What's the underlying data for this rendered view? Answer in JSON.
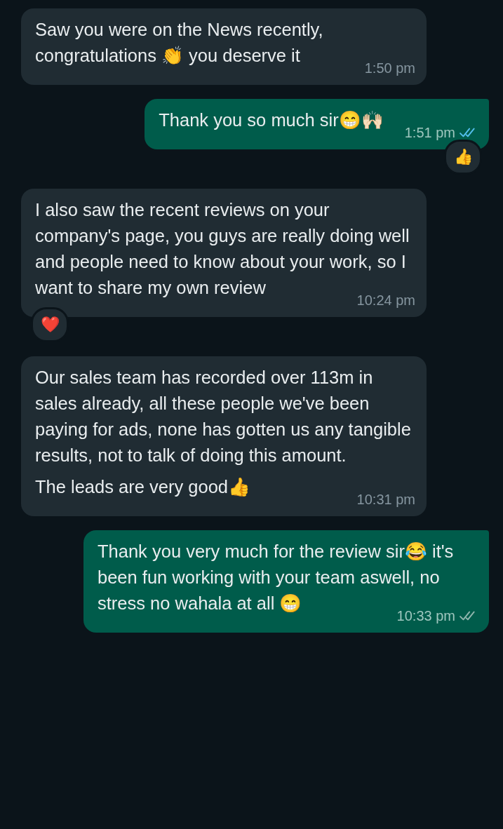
{
  "messages": [
    {
      "kind": "incoming",
      "paragraphs": [
        "Saw you were on the News recently, congratulations 👏 you deserve it"
      ],
      "time": "1:50 pm"
    },
    {
      "kind": "outgoing",
      "paragraphs": [
        "Thank you so much sir😁🙌🏻"
      ],
      "time": "1:51 pm",
      "read": true,
      "reaction": "👍"
    },
    {
      "kind": "incoming",
      "paragraphs": [
        "I also saw the recent reviews on your company's page, you guys are really doing well and people need to know about your work, so I want to share my own review"
      ],
      "time": "10:24 pm",
      "reaction": "❤️"
    },
    {
      "kind": "incoming",
      "paragraphs": [
        "Our sales team has recorded over 113m in sales already, all these people we've been paying for ads, none has gotten us any tangible results, not to talk of doing this amount.",
        "The leads are very good👍"
      ],
      "time": "10:31 pm"
    },
    {
      "kind": "outgoing",
      "paragraphs": [
        "Thank you very much for the review sir😂 it's been fun working with your team aswell, no stress no wahala at all 😁"
      ],
      "time": "10:33 pm",
      "read": false
    }
  ]
}
